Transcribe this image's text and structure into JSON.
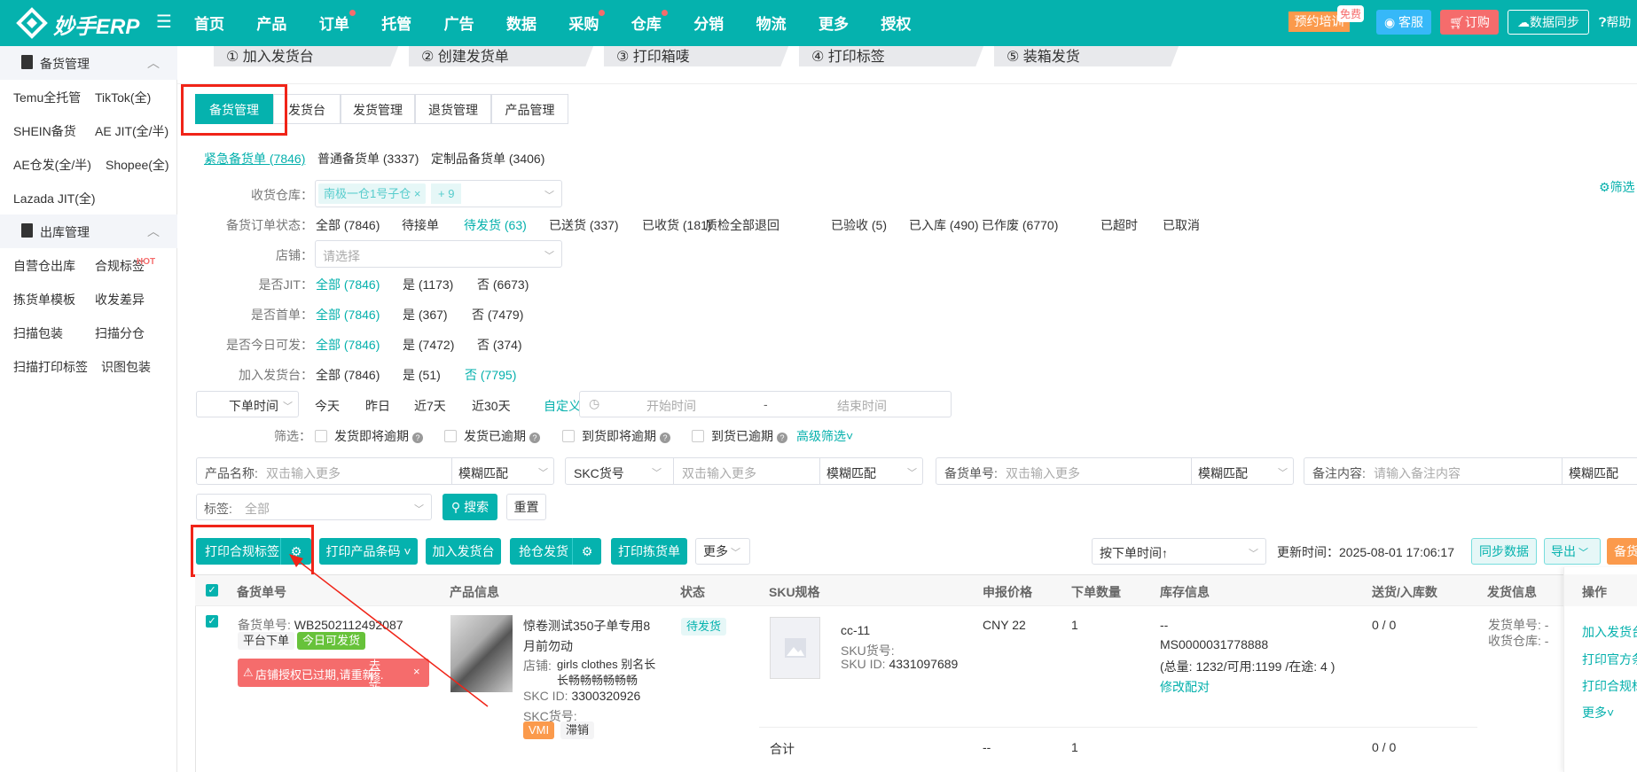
{
  "nav": {
    "logo": "妙手ERP",
    "items": [
      {
        "label": "首页",
        "dot": false
      },
      {
        "label": "产品",
        "dot": false
      },
      {
        "label": "订单",
        "dot": true
      },
      {
        "label": "托管",
        "dot": false
      },
      {
        "label": "广告",
        "dot": false
      },
      {
        "label": "数据",
        "dot": false
      },
      {
        "label": "采购",
        "dot": true
      },
      {
        "label": "仓库",
        "dot": true
      },
      {
        "label": "分销",
        "dot": false
      },
      {
        "label": "物流",
        "dot": false
      },
      {
        "label": "更多",
        "dot": false
      },
      {
        "label": "授权",
        "dot": false
      }
    ],
    "training": "预约培训",
    "free_badge": "免费",
    "service": "客服",
    "order": "订购",
    "sync": "数据同步",
    "help": "帮助"
  },
  "sidebar": {
    "groups": [
      {
        "title": "备货管理",
        "items": [
          "Temu全托管",
          "TikTok(全)",
          "SHEIN备货",
          "AE JIT(全/半)",
          "AE仓发(全/半)",
          "Shopee(全)",
          "Lazada JIT(全)"
        ]
      },
      {
        "title": "出库管理",
        "items": [
          "自营仓出库",
          "合规标签",
          "拣货单模板",
          "收发差异",
          "扫描包装",
          "扫描分仓",
          "扫描打印标签",
          "识图包装"
        ]
      }
    ],
    "hot": "HOT"
  },
  "steps": [
    "① 加入发货台",
    "② 创建发货单",
    "③ 打印箱唛",
    "④ 打印标签",
    "⑤ 装箱发货"
  ],
  "tabs": [
    "备货管理",
    "发货台",
    "发货管理",
    "退货管理",
    "产品管理"
  ],
  "order_types": [
    "紧急备货单 (7846)",
    "普通备货单 (3337)",
    "定制品备货单 (3406)"
  ],
  "filter_settings": "筛选",
  "filters": {
    "warehouse": {
      "label": "收货仓库：",
      "tag": "南极一仓1号子仓",
      "more": "+ 9"
    },
    "status": {
      "label": "备货订单状态：",
      "options": [
        "全部 (7846)",
        "待接单",
        "待发货 (63)",
        "已送货 (337)",
        "已收货 (181)",
        "质检全部退回",
        "已验收 (5)",
        "已入库 (490)",
        "已作废 (6770)",
        "已超时",
        "已取消"
      ]
    },
    "shop": {
      "label": "店铺：",
      "placeholder": "请选择"
    },
    "jit": {
      "label": "是否JIT：",
      "options": [
        "全部 (7846)",
        "是 (1173)",
        "否 (6673)"
      ]
    },
    "first": {
      "label": "是否首单：",
      "options": [
        "全部 (7846)",
        "是 (367)",
        "否 (7479)"
      ]
    },
    "today": {
      "label": "是否今日可发：",
      "options": [
        "全部 (7846)",
        "是 (7472)",
        "否 (374)"
      ]
    },
    "desk": {
      "label": "加入发货台：",
      "options": [
        "全部 (7846)",
        "是 (51)",
        "否 (7795)"
      ]
    },
    "date": {
      "type": "下单时间",
      "options": [
        "今天",
        "昨日",
        "近7天",
        "近30天",
        "自定义"
      ],
      "start": "开始时间",
      "sep": "-",
      "end": "结束时间"
    },
    "screen": {
      "label": "筛选：",
      "options": [
        "发货即将逾期",
        "发货已逾期",
        "到货即将逾期",
        "到货已逾期"
      ],
      "advanced": "高级筛选"
    }
  },
  "search": {
    "fields": [
      {
        "label": "产品名称:",
        "placeholder": "双击输入更多",
        "match": "模糊匹配"
      },
      {
        "label": "SKC货号",
        "placeholder": "双击输入更多",
        "match": "模糊匹配"
      },
      {
        "label": "备货单号:",
        "placeholder": "双击输入更多",
        "match": "模糊匹配"
      },
      {
        "label": "备注内容:",
        "placeholder": "请输入备注内容",
        "match": "模糊匹配"
      }
    ],
    "tag_label": "标签:",
    "tag_value": "全部",
    "search": "搜索",
    "reset": "重置"
  },
  "toolbar": {
    "print_label": "打印合规标签",
    "print_barcode": "打印产品条码",
    "add_desk": "加入发货台",
    "grab_ship": "抢仓发货",
    "print_pick": "打印拣货单",
    "more": "更多",
    "sort": "按下单时间↑",
    "update_time": "更新时间：2025-08-01 17:06:17",
    "sync": "同步数据",
    "export": "导出",
    "stock": "备货"
  },
  "table": {
    "headers": [
      "备货单号",
      "产品信息",
      "状态",
      "SKU规格",
      "申报价格",
      "下单数量",
      "库存信息",
      "送货/入库数",
      "发货信息",
      "操作"
    ],
    "row": {
      "order_label": "备货单号:",
      "order_no": "WB2502112492087",
      "tag1": "平台下单",
      "tag2": "今日可发货",
      "alert": "店铺授权已过期,请重新...",
      "alert_link": "去修改",
      "product": "惊卷测试350子单专用8月前勿动",
      "shop_label": "店铺:",
      "shop": "girls clothes 别名长长畅畅畅畅畅畅",
      "skc_id_label": "SKC ID:",
      "skc_id": "3300320926",
      "skc_no_label": "SKC货号:",
      "tags": [
        "VMI",
        "滞销"
      ],
      "status": "待发货",
      "sku": "cc-11",
      "sku_no_label": "SKU货号:",
      "sku_id_label": "SKU ID:",
      "sku_id": "4331097689",
      "price": "CNY 22",
      "qty": "1",
      "stock_dash": "--",
      "stock_code": "MS0000031778888",
      "stock_detail": "(总量: 1232/可用:1199 /在途: 4 )",
      "stock_link": "修改配对",
      "delivered": "0 / 0",
      "ship_no": "发货单号:  -",
      "ship_wh": "收货仓库:  -",
      "actions": [
        "加入发货台",
        "打印官方条",
        "打印合规标",
        "更多"
      ]
    },
    "total": {
      "label": "合计",
      "price": "--",
      "qty": "1",
      "delivered": "0 / 0"
    }
  }
}
